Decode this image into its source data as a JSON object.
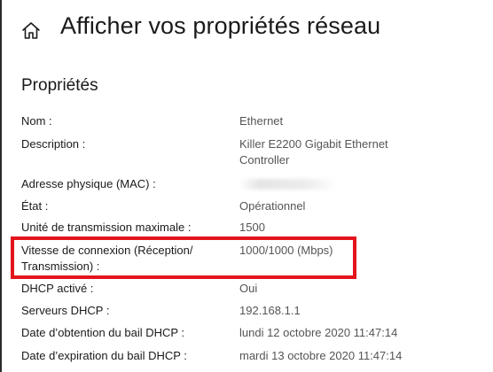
{
  "header": {
    "title": "Afficher vos propriétés réseau"
  },
  "section": {
    "title": "Propriétés"
  },
  "properties": [
    {
      "label": "Nom :",
      "value": "Ethernet"
    },
    {
      "label": "Description :",
      "value": "Killer E2200 Gigabit Ethernet Controller"
    },
    {
      "label": "Adresse physique (MAC) :",
      "value": ""
    },
    {
      "label": "État :",
      "value": "Opérationnel"
    },
    {
      "label": "Unité de transmission maximale :",
      "value": "1500"
    },
    {
      "label": "Vitesse de connexion (Réception/ Transmission) :",
      "value": "1000/1000 (Mbps)"
    },
    {
      "label": "DHCP activé :",
      "value": "Oui"
    },
    {
      "label": "Serveurs DHCP :",
      "value": "192.168.1.1"
    },
    {
      "label": "Date d’obtention du bail DHCP :",
      "value": "lundi 12 octobre 2020 11:47:14"
    },
    {
      "label": "Date d’expiration du bail DHCP :",
      "value": "mardi 13 octobre 2020 11:47:14"
    }
  ],
  "highlight_color": "#e3141c"
}
